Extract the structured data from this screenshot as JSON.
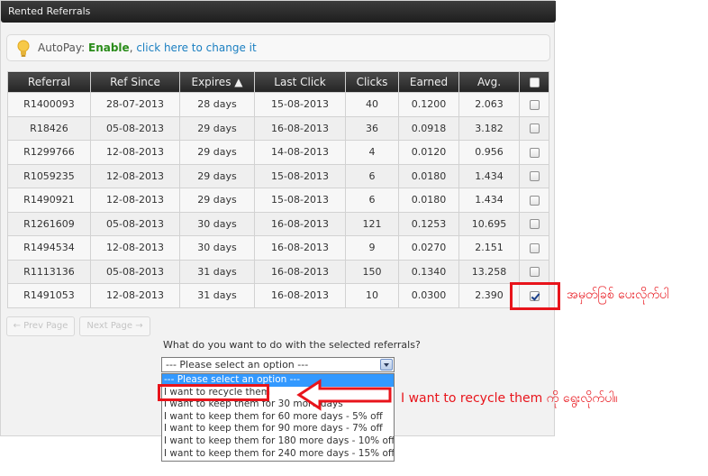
{
  "panel": {
    "title": "Rented Referrals"
  },
  "autopay": {
    "label": "AutoPay: ",
    "status": "Enable",
    "sep": ", ",
    "link": "click here to change it"
  },
  "table": {
    "headers": [
      "Referral",
      "Ref Since",
      "Expires ▲",
      "Last Click",
      "Clicks",
      "Earned",
      "Avg."
    ],
    "rows": [
      {
        "referral": "R1400093",
        "ref_since": "28-07-2013",
        "expires": "28 days",
        "last_click": "15-08-2013",
        "clicks": "40",
        "earned": "0.1200",
        "avg": "2.063",
        "checked": false
      },
      {
        "referral": "R18426",
        "ref_since": "05-08-2013",
        "expires": "29 days",
        "last_click": "16-08-2013",
        "clicks": "36",
        "earned": "0.0918",
        "avg": "3.182",
        "checked": false
      },
      {
        "referral": "R1299766",
        "ref_since": "12-08-2013",
        "expires": "29 days",
        "last_click": "14-08-2013",
        "clicks": "4",
        "earned": "0.0120",
        "avg": "0.956",
        "checked": false
      },
      {
        "referral": "R1059235",
        "ref_since": "12-08-2013",
        "expires": "29 days",
        "last_click": "15-08-2013",
        "clicks": "6",
        "earned": "0.0180",
        "avg": "1.434",
        "checked": false
      },
      {
        "referral": "R1490921",
        "ref_since": "12-08-2013",
        "expires": "29 days",
        "last_click": "15-08-2013",
        "clicks": "6",
        "earned": "0.0180",
        "avg": "1.434",
        "checked": false
      },
      {
        "referral": "R1261609",
        "ref_since": "05-08-2013",
        "expires": "30 days",
        "last_click": "16-08-2013",
        "clicks": "121",
        "earned": "0.1253",
        "avg": "10.695",
        "checked": false
      },
      {
        "referral": "R1494534",
        "ref_since": "12-08-2013",
        "expires": "30 days",
        "last_click": "16-08-2013",
        "clicks": "9",
        "earned": "0.0270",
        "avg": "2.151",
        "checked": false
      },
      {
        "referral": "R1113136",
        "ref_since": "05-08-2013",
        "expires": "31 days",
        "last_click": "16-08-2013",
        "clicks": "150",
        "earned": "0.1340",
        "avg": "13.258",
        "checked": false
      },
      {
        "referral": "R1491053",
        "ref_since": "12-08-2013",
        "expires": "31 days",
        "last_click": "16-08-2013",
        "clicks": "10",
        "earned": "0.0300",
        "avg": "2.390",
        "checked": true
      }
    ]
  },
  "pager": {
    "prev": "← Prev Page",
    "next": "Next Page →"
  },
  "action": {
    "question": "What do you want to do with the selected referrals?",
    "selected": "--- Please select an option ---",
    "options": [
      "--- Please select an option ---",
      "I want to recycle them",
      "I want to keep them for 30 more days",
      "I want to keep them for 60 more days - 5% off",
      "I want to keep them for 90 more days - 7% off",
      "I want to keep them for 180 more days - 10% off",
      "I want to keep them for 240 more days - 15% off"
    ]
  },
  "annotations": {
    "checkbox_note": "အမှတ်ခြစ် ပေးလိုက်ပါ",
    "recycle_note": "I want to recycle them ကို ရွေးလိုက်ပါ။"
  },
  "colors": {
    "annotation": "#e8141b",
    "enable": "#2a8c1a",
    "link": "#1b7fc1",
    "highlight": "#3399ff"
  }
}
